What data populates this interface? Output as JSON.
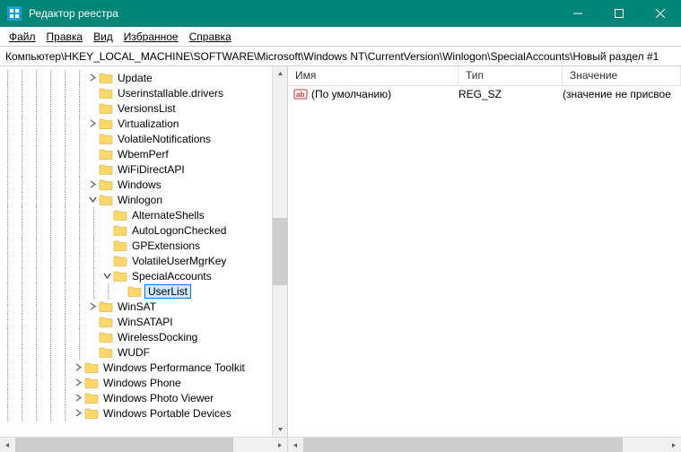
{
  "title": "Редактор реестра",
  "menu": {
    "file": "Файл",
    "edit": "Правка",
    "view": "Вид",
    "favorites": "Избранное",
    "help": "Справка"
  },
  "address": "Компьютер\\HKEY_LOCAL_MACHINE\\SOFTWARE\\Microsoft\\Windows NT\\CurrentVersion\\Winlogon\\SpecialAccounts\\Новый раздел #1",
  "tree": [
    {
      "depth": 6,
      "exp": "closed",
      "label": "Update"
    },
    {
      "depth": 6,
      "exp": "none",
      "label": "Userinstallable.drivers"
    },
    {
      "depth": 6,
      "exp": "none",
      "label": "VersionsList"
    },
    {
      "depth": 6,
      "exp": "closed",
      "label": "Virtualization"
    },
    {
      "depth": 6,
      "exp": "none",
      "label": "VolatileNotifications"
    },
    {
      "depth": 6,
      "exp": "none",
      "label": "WbemPerf"
    },
    {
      "depth": 6,
      "exp": "none",
      "label": "WiFiDirectAPI"
    },
    {
      "depth": 6,
      "exp": "closed",
      "label": "Windows"
    },
    {
      "depth": 6,
      "exp": "open",
      "label": "Winlogon"
    },
    {
      "depth": 7,
      "exp": "none",
      "label": "AlternateShells"
    },
    {
      "depth": 7,
      "exp": "none",
      "label": "AutoLogonChecked"
    },
    {
      "depth": 7,
      "exp": "none",
      "label": "GPExtensions"
    },
    {
      "depth": 7,
      "exp": "none",
      "label": "VolatileUserMgrKey"
    },
    {
      "depth": 7,
      "exp": "open",
      "label": "SpecialAccounts"
    },
    {
      "depth": 8,
      "exp": "none",
      "label": "UserList",
      "editing": true
    },
    {
      "depth": 6,
      "exp": "closed",
      "label": "WinSAT"
    },
    {
      "depth": 6,
      "exp": "none",
      "label": "WinSATAPI"
    },
    {
      "depth": 6,
      "exp": "none",
      "label": "WirelessDocking"
    },
    {
      "depth": 6,
      "exp": "none",
      "label": "WUDF"
    },
    {
      "depth": 5,
      "exp": "closed",
      "label": "Windows Performance Toolkit"
    },
    {
      "depth": 5,
      "exp": "closed",
      "label": "Windows Phone"
    },
    {
      "depth": 5,
      "exp": "closed",
      "label": "Windows Photo Viewer"
    },
    {
      "depth": 5,
      "exp": "closed",
      "label": "Windows Portable Devices"
    }
  ],
  "list": {
    "columns": {
      "name": "Имя",
      "type": "Тип",
      "value": "Значение"
    },
    "rows": [
      {
        "name": "(По умолчанию)",
        "type": "REG_SZ",
        "value": "(значение не присвое"
      }
    ]
  }
}
